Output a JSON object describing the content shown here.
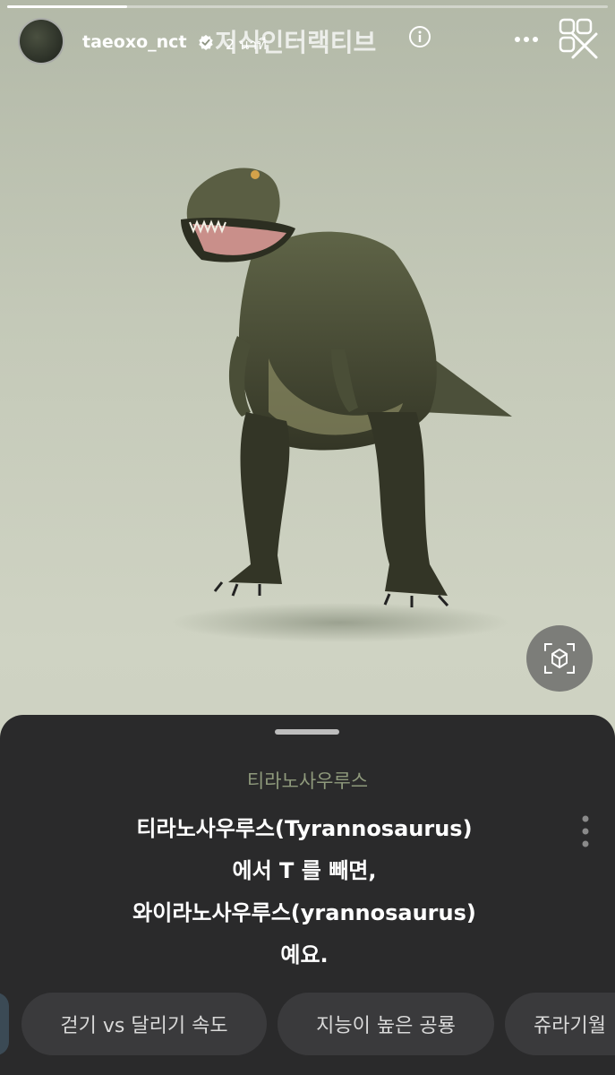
{
  "story": {
    "username": "taeoxo_nct",
    "time": "2 นาที",
    "ar_title": "지식인터랙티브",
    "progress_fraction": 0.2
  },
  "icons": {
    "verified": "verified-badge-icon",
    "info": "info-icon",
    "more": "more-horizontal-icon",
    "effects": "effects-icon",
    "close": "close-icon",
    "view_toggle": "3d-view-icon",
    "kebab": "kebab-menu-icon"
  },
  "sheet": {
    "subtitle": "티라노사우루스",
    "lines": [
      "티라노사우루스(Tyrannosaurus)",
      "에서 T 를 빼면,",
      "와이라노사우루스(yrannosaurus)",
      "예요."
    ]
  },
  "chips": [
    "걷기 vs 달리기 속도",
    "지능이 높은 공룡",
    "쥬라기월"
  ],
  "colors": {
    "accent_subtitle": "#8f9a7c",
    "sheet_bg": "#2a2a2b",
    "chip_bg": "#3a3a3c"
  }
}
